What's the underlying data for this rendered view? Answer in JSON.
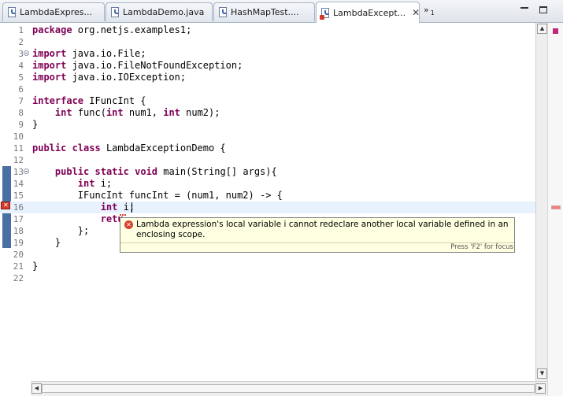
{
  "tabs": [
    {
      "label": "LambdaExpres...",
      "active": false,
      "error": false
    },
    {
      "label": "LambdaDemo.java",
      "active": false,
      "error": false
    },
    {
      "label": "HashMapTest....",
      "active": false,
      "error": false
    },
    {
      "label": "LambdaExcept...",
      "active": true,
      "error": true
    }
  ],
  "tab_overflow": {
    "symbol": "»",
    "count": "1"
  },
  "editor": {
    "line_numbers": [
      "1",
      "2",
      "3",
      "4",
      "5",
      "6",
      "7",
      "8",
      "9",
      "10",
      "11",
      "12",
      "13",
      "14",
      "15",
      "16",
      "17",
      "18",
      "19",
      "20",
      "21",
      "22"
    ],
    "lines": {
      "l1": {
        "kw": "package",
        "rest": " org.netjs.examples1;"
      },
      "l3": {
        "kw": "import",
        "rest": " java.io.File;"
      },
      "l4": {
        "kw": "import",
        "rest": " java.io.FileNotFoundException;"
      },
      "l5": {
        "kw": "import",
        "rest": " java.io.IOException;"
      },
      "l7": {
        "kw": "interface",
        "rest": " IFuncInt {"
      },
      "l8": {
        "indent": "    ",
        "kw1": "int",
        "mid1": " func(",
        "kw2": "int",
        "mid2": " num1, ",
        "kw3": "int",
        "rest": " num2);"
      },
      "l9": {
        "rest": "}"
      },
      "l11": {
        "kw1": "public",
        "sp": " ",
        "kw2": "class",
        "rest": " LambdaExceptionDemo {"
      },
      "l13": {
        "indent": "    ",
        "kw1": "public",
        "kw2": "static",
        "kw3": "void",
        "rest": " main(String[] args){"
      },
      "l14": {
        "indent": "        ",
        "kw": "int",
        "rest": " i;"
      },
      "l15": {
        "indent": "        ",
        "rest": "IFuncInt funcInt = (num1, num2) -> {"
      },
      "l16": {
        "indent": "            ",
        "kw": "int",
        "rest": " i;"
      },
      "l17": {
        "indent": "            ",
        "rest": "retu"
      },
      "l18": {
        "indent": "        ",
        "rest": "};"
      },
      "l19": {
        "indent": "    ",
        "rest": "}"
      },
      "l21": {
        "rest": "}"
      }
    }
  },
  "tooltip": {
    "message": "Lambda expression's local variable i cannot redeclare another local variable defined in an enclosing scope.",
    "status": "Press 'F2' for focus"
  },
  "scroll": {
    "up_symbol": "▲",
    "down_symbol": "▼",
    "left_symbol": "◀",
    "right_symbol": "▶"
  }
}
